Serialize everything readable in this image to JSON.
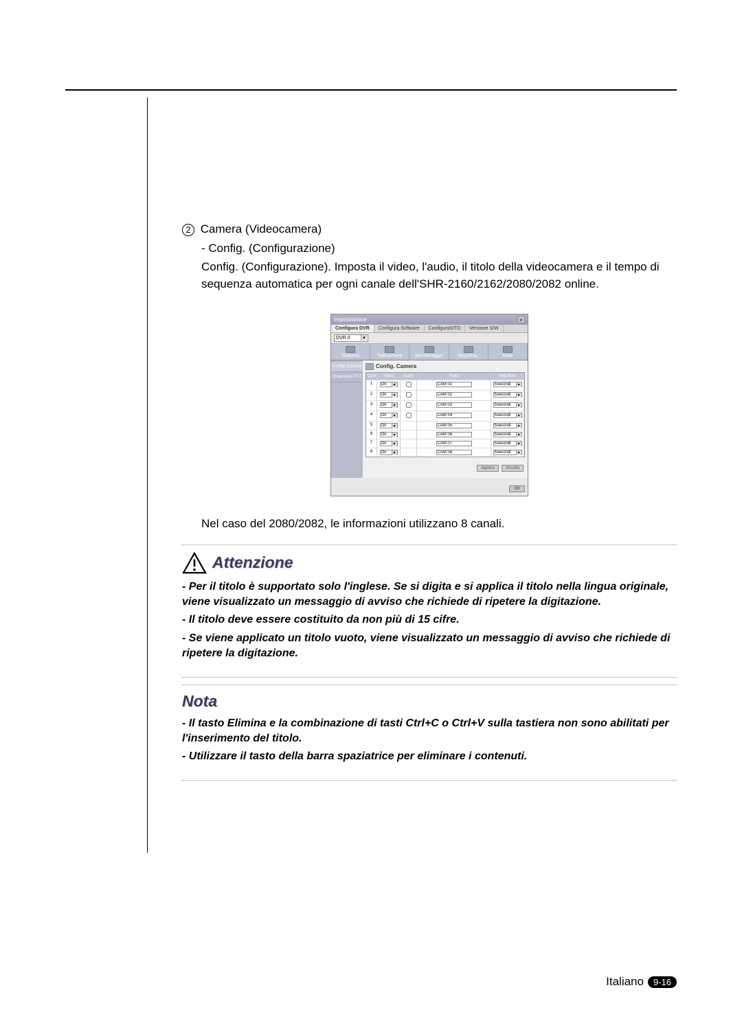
{
  "section": {
    "number": "2",
    "title": "Camera (Videocamera)",
    "sub": "- Config. (Configurazione)",
    "desc": "Config. (Configurazione). Imposta il video, l'audio, il titolo della videocamera e il tempo di sequenza automatica per ogni canale dell'SHR-2160/2162/2080/2082 online."
  },
  "screenshot": {
    "window_title": "Impostazione",
    "close": "✕",
    "tabs": [
      "Configura DVR",
      "Configura Software",
      "ConfiguraSITO",
      "Versione S/W"
    ],
    "dvr_label": "DVR 0",
    "mode_tabs": [
      "Sistema",
      "Telecamere",
      "Monitoraggio",
      "Registraz.",
      "Rete"
    ],
    "side_items": [
      "Config. Camera",
      "Dispositivo PTZ"
    ],
    "panel_title": "Config. Camera",
    "headers": {
      "cam": "Cam",
      "video": "Video",
      "audio": "Audio",
      "titolo": "Titolo",
      "seq": "Seq Auto"
    },
    "rows": [
      {
        "n": "1",
        "video": "On",
        "audio": true,
        "title": "CAM 01",
        "seq": "5secondi"
      },
      {
        "n": "2",
        "video": "On",
        "audio": true,
        "title": "CAM 02",
        "seq": "5secondi"
      },
      {
        "n": "3",
        "video": "On",
        "audio": true,
        "title": "CAM 03",
        "seq": "5secondi"
      },
      {
        "n": "4",
        "video": "On",
        "audio": true,
        "title": "CAM 04",
        "seq": "5secondi"
      },
      {
        "n": "5",
        "video": "On",
        "audio": false,
        "title": "CAM 05",
        "seq": "5secondi"
      },
      {
        "n": "6",
        "video": "On",
        "audio": false,
        "title": "CAM 06",
        "seq": "5secondi"
      },
      {
        "n": "7",
        "video": "On",
        "audio": false,
        "title": "CAM 07",
        "seq": "5secondi"
      },
      {
        "n": "8",
        "video": "On",
        "audio": false,
        "title": "CAM 08",
        "seq": "5secondi"
      }
    ],
    "apply": "Applica",
    "cancel": "Annulla",
    "ok": "OK"
  },
  "note_after": "Nel caso del 2080/2082, le informazioni utilizzano 8 canali.",
  "attenzione": {
    "title": "Attenzione",
    "items": [
      "- Per il titolo è supportato solo l'inglese. Se si digita e si applica il titolo nella lingua originale, viene visualizzato un messaggio di avviso che richiede di ripetere la digitazione.",
      "- Il titolo deve essere costituito da non più di 15 cifre.",
      "- Se viene applicato un titolo vuoto, viene visualizzato un messaggio di avviso che richiede di ripetere la digitazione."
    ]
  },
  "nota": {
    "title": "Nota",
    "items": [
      "- Il tasto Elimina e la combinazione di tasti Ctrl+C o Ctrl+V sulla tastiera non sono abilitati per l'inserimento del titolo.",
      "- Utilizzare il tasto della barra spaziatrice per eliminare i contenuti."
    ]
  },
  "footer": {
    "lang": "Italiano",
    "page": "9-16"
  }
}
